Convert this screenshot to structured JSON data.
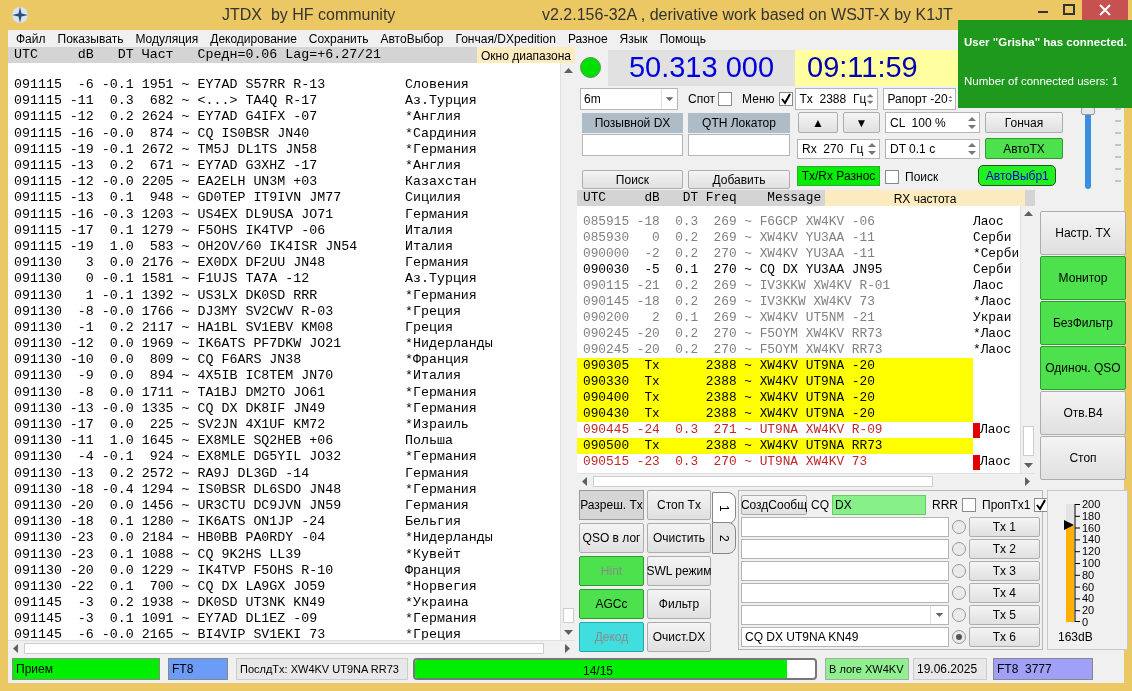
{
  "window": {
    "title": "JTDX  by HF community",
    "subtitle": "v2.2.156-32A , derivative work based on WSJT-X by K1JT"
  },
  "menu": [
    "Файл",
    "Показывать",
    "Модуляция",
    "Декодирование",
    "Сохранить",
    "АвтоВыбор",
    "Гончая/DXpedition",
    "Разное",
    "Язык",
    "Помощь"
  ],
  "band_activity": {
    "header": "UTC     dB   DT Част   Средн=0.06 Lag=+6.27/21",
    "label": "Окно диапазона",
    "rows": [
      {
        "text": "091115  -6 -0.1 1951 ~ EY7AD S57RR R-13",
        "country": "Словения"
      },
      {
        "text": "091115 -11  0.3  682 ~ <...> TA4Q R-17",
        "country": "Аз.Турция"
      },
      {
        "text": "091115 -12  0.2 2624 ~ EY7AD G4IFX -07",
        "country": "*Англия"
      },
      {
        "text": "091115 -16 -0.0  874 ~ CQ IS0BSR JN40",
        "country": "*Сардиния"
      },
      {
        "text": "091115 -19 -0.1 2672 ~ TM5J DL1TS JN58",
        "country": "*Германия"
      },
      {
        "text": "091115 -13  0.2  671 ~ EY7AD G3XHZ -17",
        "country": "*Англия"
      },
      {
        "text": "091115 -12 -0.0 2205 ~ EA2ELH UN3M +03",
        "country": "Казахстан"
      },
      {
        "text": "091115 -13  0.1  948 ~ GD0TEP IT9IVN JM77",
        "country": "Сицилия"
      },
      {
        "text": "091115 -16 -0.3 1203 ~ US4EX DL9USA JO71",
        "country": "Германия"
      },
      {
        "text": "091115 -17  0.1 1279 ~ F5OHS IK4TVP -06",
        "country": "Италия"
      },
      {
        "text": "091115 -19  1.0  583 ~ OH2OV/60 IK4ISR JN54",
        "country": "Италия"
      },
      {
        "text": "091130   3  0.0 2176 ~ EX0DX DF2UU JN48",
        "country": "Германия"
      },
      {
        "text": "091130   0 -0.1 1581 ~ F1UJS TA7A -12",
        "country": "Аз.Турция"
      },
      {
        "text": "091130   1 -0.1 1392 ~ US3LX DK0SD RRR",
        "country": "*Германия"
      },
      {
        "text": "091130  -8 -0.0 1766 ~ DJ3MY SV2CWV R-03",
        "country": "*Греция"
      },
      {
        "text": "091130  -1  0.2 2117 ~ HA1BL SV1EBV KM08",
        "country": "Греция"
      },
      {
        "text": "091130 -12  0.0 1969 ~ IK6ATS PF7DKW JO21",
        "country": "*Нидерланды"
      },
      {
        "text": "091130 -10  0.0  809 ~ CQ F6ARS JN38",
        "country": "*Франция"
      },
      {
        "text": "091130  -9  0.0  894 ~ 4X5IB IC8TEM JN70",
        "country": "*Италия"
      },
      {
        "text": "091130  -8  0.0 1711 ~ TA1BJ DM2TO JO61",
        "country": "*Германия"
      },
      {
        "text": "091130 -13 -0.0 1335 ~ CQ DX DK8IF JN49",
        "country": "*Германия"
      },
      {
        "text": "091130 -17  0.0  225 ~ SV2JN 4X1UF KM72",
        "country": "*Израиль"
      },
      {
        "text": "091130 -11  1.0 1645 ~ EX8MLE SQ2HEB +06",
        "country": "Польша"
      },
      {
        "text": "091130  -4 -0.1  924 ~ EX8MLE DG5YIL JO32",
        "country": "*Германия"
      },
      {
        "text": "091130 -13  0.2 2572 ~ RA9J DL3GD -14",
        "country": "Германия"
      },
      {
        "text": "091130 -18 -0.4 1294 ~ IS0BSR DL6SDO JN48",
        "country": "*Германия"
      },
      {
        "text": "091130 -20  0.0 1456 ~ UR3CTU DC9JVN JN59",
        "country": "Германия"
      },
      {
        "text": "091130 -18  0.1 1280 ~ IK6ATS ON1JP -24",
        "country": "Бельгия"
      },
      {
        "text": "091130 -23  0.0 2184 ~ HB0BB PA0RDY -04",
        "country": "*Нидерланды"
      },
      {
        "text": "091130 -23  0.1 1088 ~ CQ 9K2HS LL39",
        "country": "*Кувейт"
      },
      {
        "text": "091130 -20  0.0 1229 ~ IK4TVP F5OHS R-10",
        "country": "Франция"
      },
      {
        "text": "091130 -22  0.1  700 ~ CQ DX LA9GX JO59",
        "country": "*Норвегия"
      },
      {
        "text": "091145  -3  0.2 1938 ~ DK0SD UT3NK KN49",
        "country": "*Украина"
      },
      {
        "text": "091145  -3  0.1 1091 ~ EY7AD DL1EZ -09",
        "country": "*Германия"
      },
      {
        "text": "091145  -6 -0.0 2165 ~ BI4VIP SV1EKI 73",
        "country": "*Греция"
      }
    ]
  },
  "top": {
    "frequency": "50.313 000",
    "clock": "09:11:59",
    "band": "6m",
    "spot": {
      "label": "Спот",
      "checked": false
    },
    "menu": {
      "label": "Меню",
      "checked": true
    },
    "tx_freq": "Tx  2388  Гц",
    "report": "Рапорт -20",
    "dx_call_label": "Позывной DX",
    "dx_grid_label": "QTH Локатор",
    "up": "▲",
    "down": "▼",
    "cl": "CL  100 %",
    "hound": {
      "label": "Гончая",
      "on": false
    },
    "rx_freq": "Rx  270  Гц",
    "dt": "DT 0.1 с",
    "auto_tx": {
      "label": "АвтоTX",
      "on": true
    },
    "lookup": "Поиск",
    "add": "Добавить",
    "split": {
      "label": "Tx/Rx Разнос",
      "on": true
    },
    "search": {
      "label": "Поиск",
      "checked": false
    },
    "auto_seq": {
      "label": "АвтоВыбр1",
      "on": true
    }
  },
  "power_slider": {
    "level": 0.97
  },
  "rx_frequency": {
    "header": "UTC     dB   DT Freq    Message",
    "label": "RX частота",
    "rows": [
      {
        "text": "085915 -18  0.3  269 ~ F6GCP XW4KV -06",
        "country": "Лаос",
        "kind": "old"
      },
      {
        "text": "085930   0  0.2  269 ~ XW4KV YU3AA -11",
        "country": "Серби",
        "kind": "old"
      },
      {
        "text": "090000  -2  0.2  270 ~ XW4KV YU3AA -11",
        "country": "*Серби",
        "kind": "old"
      },
      {
        "text": "090030  -5  0.1  270 ~ CQ DX YU3AA JN95",
        "country": "Серби",
        "kind": "normal"
      },
      {
        "text": "090115 -21  0.2  269 ~ IV3KKW XW4KV R-01",
        "country": "Лаос",
        "kind": "old"
      },
      {
        "text": "090145 -18  0.2  269 ~ IV3KKW XW4KV 73",
        "country": "*Лаос",
        "kind": "old"
      },
      {
        "text": "090200   2  0.1  269 ~ XW4KV UT5NM -21",
        "country": "Украи",
        "kind": "old"
      },
      {
        "text": "090245 -20  0.2  270 ~ F5OYM XW4KV RR73",
        "country": "*Лаос",
        "kind": "old"
      },
      {
        "text": "090245 -20  0.2  270 ~ F5OYM XW4KV RR73",
        "country": "*Лаос",
        "kind": "old"
      },
      {
        "text": "090305  Tx      2388 ~ XW4KV UT9NA -20",
        "kind": "tx"
      },
      {
        "text": "090330  Tx      2388 ~ XW4KV UT9NA -20",
        "kind": "tx"
      },
      {
        "text": "090400  Tx      2388 ~ XW4KV UT9NA -20",
        "kind": "tx"
      },
      {
        "text": "090430  Tx      2388 ~ XW4KV UT9NA -20",
        "kind": "tx"
      },
      {
        "text": "090445 -24  0.3  271 ~ UT9NA XW4KV R-09",
        "country": "Лаос",
        "kind": "reply"
      },
      {
        "text": "090500  Tx      2388 ~ XW4KV UT9NA RR73",
        "kind": "tx"
      },
      {
        "text": "090515 -23  0.3  270 ~ UT9NA XW4KV 73",
        "country": "Лаос",
        "kind": "reply"
      }
    ]
  },
  "side_buttons": [
    {
      "label": "Настр. TX",
      "on": false
    },
    {
      "label": "Монитор",
      "on": true
    },
    {
      "label": "БезФильтр",
      "on": true
    },
    {
      "label": "Одиноч. QSO",
      "on": true
    },
    {
      "label": "Отв.B4",
      "on": false
    },
    {
      "label": "Стоп",
      "on": false
    }
  ],
  "action_buttons": [
    {
      "label": "Разреш. Tx",
      "kind": "pressed",
      "disabled": false
    },
    {
      "label": "QSO в лог",
      "kind": "plain",
      "disabled": false
    },
    {
      "label": "Hint",
      "kind": "green",
      "disabled": true
    },
    {
      "label": "AGCc",
      "kind": "green",
      "disabled": false
    },
    {
      "label": "Декод",
      "kind": "cyan",
      "disabled": true
    },
    {
      "label": "Стоп Tx",
      "kind": "plain",
      "disabled": false
    },
    {
      "label": "Очистить",
      "kind": "plain",
      "disabled": false
    },
    {
      "label": "SWL режим",
      "kind": "plain",
      "disabled": false
    },
    {
      "label": "Фильтр",
      "kind": "plain",
      "disabled": false
    },
    {
      "label": "Очист.DX",
      "kind": "plain",
      "disabled": false
    }
  ],
  "message_tabs": [
    {
      "label": "1",
      "selected": true
    },
    {
      "label": "2",
      "selected": false
    }
  ],
  "messages": {
    "generate": "СоздСообщ",
    "cq_label": "CQ",
    "cq_value": "DX",
    "rrr": {
      "label": "RRR",
      "checked": false
    },
    "skip_tx1": {
      "label": "ПропTx1",
      "checked": true
    },
    "rows": [
      {
        "kind": "field",
        "selected": false,
        "button": "Tx 1"
      },
      {
        "kind": "field",
        "selected": false,
        "button": "Tx 2"
      },
      {
        "kind": "field",
        "selected": false,
        "button": "Tx 3"
      },
      {
        "kind": "field",
        "selected": false,
        "button": "Tx 4"
      },
      {
        "kind": "combo",
        "selected": false,
        "button": "Tx 5"
      },
      {
        "kind": "field",
        "value": "CQ DX UT9NA KN49",
        "selected": true,
        "button": "Tx 6"
      }
    ]
  },
  "signal_meter": {
    "ticks": [
      "200",
      "180",
      "160",
      "140",
      "120",
      "100",
      "80",
      "60",
      "40",
      "20",
      "0"
    ],
    "level": 0.815,
    "reading": "163dB"
  },
  "status_bar": {
    "state": "Прием",
    "mode": "FT8",
    "last_tx": "ПослдTx: XW4KV UT9NA RR73",
    "progress": {
      "label": "14/15",
      "level": 0.93
    },
    "logged": "В логе XW4KV",
    "date": "19.06.2025",
    "mode_freq": "FT8  3777"
  },
  "toast": {
    "title": "User \"Grisha\" has connected.",
    "text": "Number of connected users: 1"
  }
}
